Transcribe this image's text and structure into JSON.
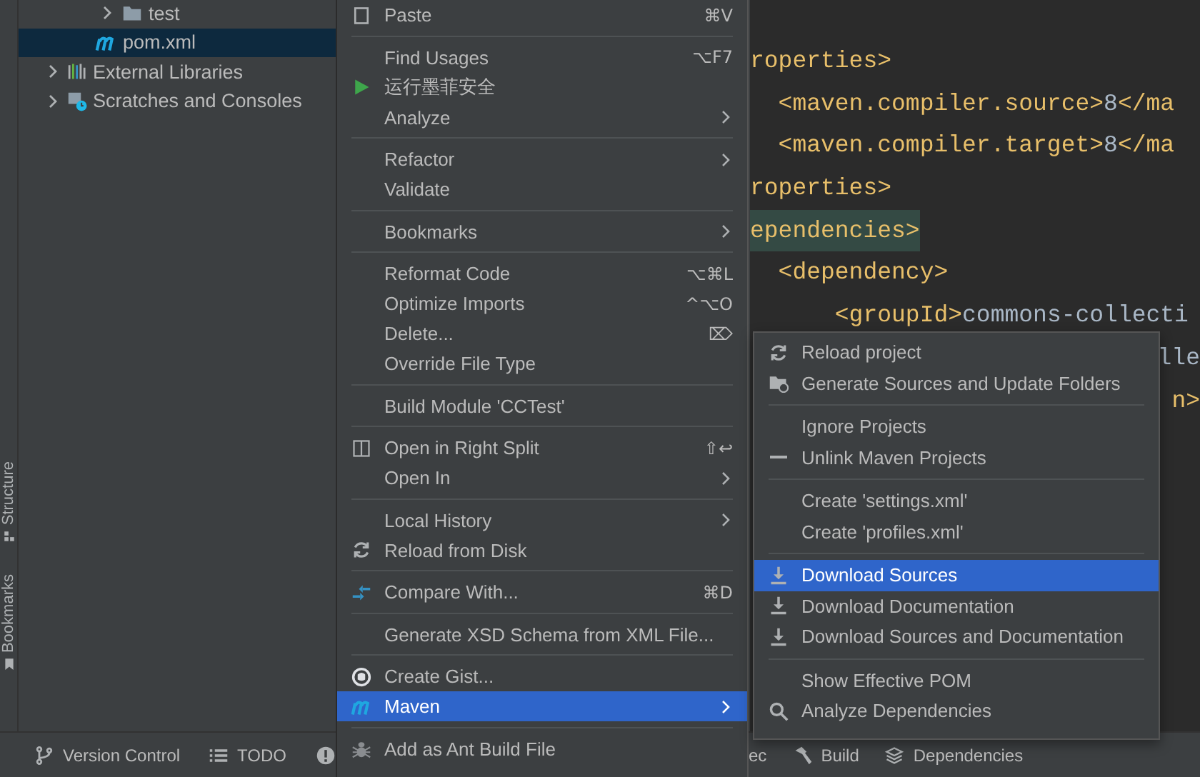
{
  "tool_stripe": {
    "tabs": [
      {
        "label": "Structure",
        "kind": "structure"
      },
      {
        "label": "Bookmarks",
        "kind": "bookmark"
      }
    ]
  },
  "project_tree": [
    {
      "children": [
        {
          "children": [
            {
              "label": "test",
              "kind": "folder",
              "expanded": false,
              "selected": false
            }
          ]
        },
        {
          "label": "pom.xml",
          "kind": "maven",
          "selected": true
        }
      ]
    },
    {
      "label": "External Libraries",
      "kind": "libraries",
      "expanded": false,
      "selected": false
    },
    {
      "label": "Scratches and Consoles",
      "kind": "scratches",
      "expanded": false,
      "selected": false
    }
  ],
  "context_menu": {
    "groups": [
      [
        {
          "label": "Paste",
          "kind": "paste",
          "shortcut": "⌘V",
          "submenu": false,
          "selected": false
        }
      ],
      [
        {
          "label": "Find Usages",
          "shortcut": "⌥F7",
          "submenu": false,
          "selected": false
        },
        {
          "label": "运行墨菲安全",
          "kind": "run",
          "submenu": false,
          "selected": false
        },
        {
          "label": "Analyze",
          "submenu": true,
          "selected": false
        }
      ],
      [
        {
          "label": "Refactor",
          "submenu": true,
          "selected": false
        },
        {
          "label": "Validate",
          "submenu": false,
          "selected": false
        }
      ],
      [
        {
          "label": "Bookmarks",
          "submenu": true,
          "selected": false
        }
      ],
      [
        {
          "label": "Reformat Code",
          "shortcut": "⌥⌘L",
          "submenu": false,
          "selected": false
        },
        {
          "label": "Optimize Imports",
          "shortcut": "^⌥O",
          "submenu": false,
          "selected": false
        },
        {
          "label": "Delete...",
          "shortcut": "⌦",
          "submenu": false,
          "selected": false
        },
        {
          "label": "Override File Type",
          "submenu": false,
          "selected": false
        }
      ],
      [
        {
          "label": "Build Module 'CCTest'",
          "submenu": false,
          "selected": false
        }
      ],
      [
        {
          "label": "Open in Right Split",
          "kind": "split",
          "shortcut": "⇧↩",
          "submenu": false,
          "selected": false
        },
        {
          "label": "Open In",
          "submenu": true,
          "selected": false
        }
      ],
      [
        {
          "label": "Local History",
          "submenu": true,
          "selected": false
        },
        {
          "label": "Reload from Disk",
          "kind": "reload",
          "submenu": false,
          "selected": false
        }
      ],
      [
        {
          "label": "Compare With...",
          "kind": "compare",
          "shortcut": "⌘D",
          "submenu": false,
          "selected": false
        }
      ],
      [
        {
          "label": "Generate XSD Schema from XML File...",
          "submenu": false,
          "selected": false
        }
      ],
      [
        {
          "label": "Create Gist...",
          "kind": "github",
          "submenu": false,
          "selected": false
        },
        {
          "label": "Maven",
          "kind": "maven",
          "submenu": true,
          "selected": true
        }
      ],
      [
        {
          "label": "Add as Ant Build File",
          "kind": "ant",
          "submenu": false,
          "selected": false
        }
      ]
    ]
  },
  "maven_submenu": {
    "groups": [
      [
        {
          "label": "Reload project",
          "kind": "reload",
          "selected": false
        },
        {
          "label": "Generate Sources and Update Folders",
          "kind": "folder-reload",
          "selected": false
        }
      ],
      [
        {
          "label": "Ignore Projects",
          "selected": false
        },
        {
          "label": "Unlink Maven Projects",
          "kind": "minus",
          "selected": false
        }
      ],
      [
        {
          "label": "Create 'settings.xml'",
          "selected": false
        },
        {
          "label": "Create 'profiles.xml'",
          "selected": false
        }
      ],
      [
        {
          "label": "Download Sources",
          "kind": "download",
          "selected": true
        },
        {
          "label": "Download Documentation",
          "kind": "download",
          "selected": false
        },
        {
          "label": "Download Sources and Documentation",
          "kind": "download",
          "selected": false
        }
      ],
      [
        {
          "label": "Show Effective POM",
          "selected": false
        },
        {
          "label": "Analyze Dependencies",
          "kind": "search",
          "selected": false
        }
      ]
    ]
  },
  "editor": {
    "lines": [
      {
        "kind": "full",
        "highlighted": false,
        "segments": [
          {
            "text": "roperties>",
            "kind": "tag"
          }
        ]
      },
      {
        "kind": "full",
        "highlighted": false,
        "segments": [
          {
            "text": "  <maven.compiler.source>",
            "kind": "tag"
          },
          {
            "text": "8",
            "kind": "value"
          },
          {
            "text": "</ma",
            "kind": "tag"
          }
        ]
      },
      {
        "kind": "full",
        "highlighted": false,
        "segments": [
          {
            "text": "  <maven.compiler.target>",
            "kind": "tag"
          },
          {
            "text": "8",
            "kind": "value"
          },
          {
            "text": "</ma",
            "kind": "tag"
          }
        ]
      },
      {
        "kind": "full",
        "highlighted": false,
        "segments": [
          {
            "text": "roperties>",
            "kind": "tag"
          }
        ]
      },
      {
        "kind": "full",
        "highlighted": true,
        "segments": [
          {
            "text": "ependencies>",
            "kind": "tag"
          }
        ]
      },
      {
        "kind": "full",
        "highlighted": false,
        "segments": [
          {
            "text": "  <dependency>",
            "kind": "tag"
          }
        ]
      },
      {
        "kind": "full",
        "highlighted": false,
        "segments": [
          {
            "text": "      <groupId>",
            "kind": "tag"
          },
          {
            "text": "commons-collecti",
            "kind": "value"
          }
        ]
      },
      {
        "kind": "partial",
        "highlighted": false,
        "segments": [
          {
            "text": "lle",
            "kind": "value"
          }
        ]
      },
      {
        "kind": "partial",
        "highlighted": false,
        "segments": [
          {
            "text": "n>",
            "kind": "tag"
          }
        ]
      }
    ]
  },
  "bottom_bar": {
    "left": [
      {
        "label": "Version Control",
        "kind": "branch"
      },
      {
        "label": "TODO",
        "kind": "list"
      },
      {
        "kind": "warning"
      }
    ],
    "right": [
      {
        "label": "ec"
      },
      {
        "label": "Build",
        "kind": "hammer"
      },
      {
        "label": "Dependencies",
        "kind": "layers"
      }
    ]
  }
}
